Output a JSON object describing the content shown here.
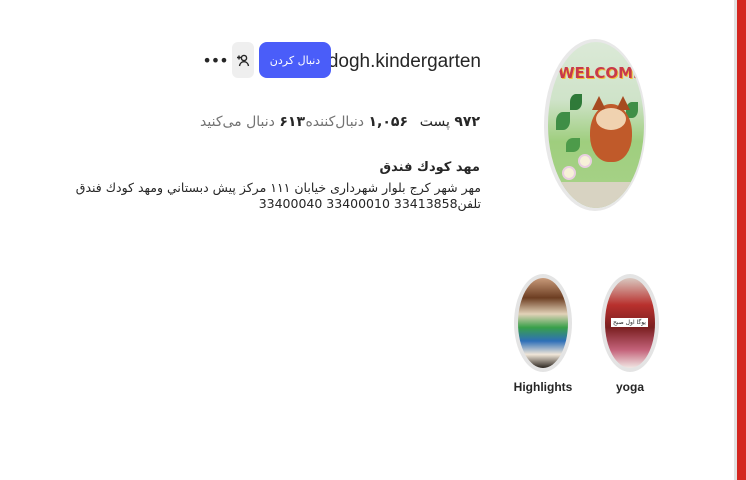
{
  "profile": {
    "username": "fandogh.kindergarten",
    "follow_label": "دنبال کردن",
    "more_label": "•••",
    "stats": {
      "posts_count": "۹۷۲",
      "posts_label": "پست",
      "followers_count": "۱,۰۵۶",
      "followers_label": "دنبال‌کننده",
      "following_count": "۶۱۳",
      "following_label": "دنبال می‌کنید"
    },
    "bio_name": "مهد كودك فندق",
    "bio_text": "مهر شهر کرج بلوار شهرداری خیابان ۱۱۱ مركز پيش دبستاني ومهد كودك فندق تلفن33413858 33400010 33400040",
    "avatar_text": "WELCOME"
  },
  "highlights": [
    {
      "label": "yoga",
      "caption": "يوگا اول صبح"
    },
    {
      "label": "Highlights"
    }
  ],
  "icons": {
    "suggest": "person-add-icon",
    "more": "ellipsis-icon"
  },
  "colors": {
    "accent": "#4a5df9",
    "side_bar": "#d4261f"
  }
}
